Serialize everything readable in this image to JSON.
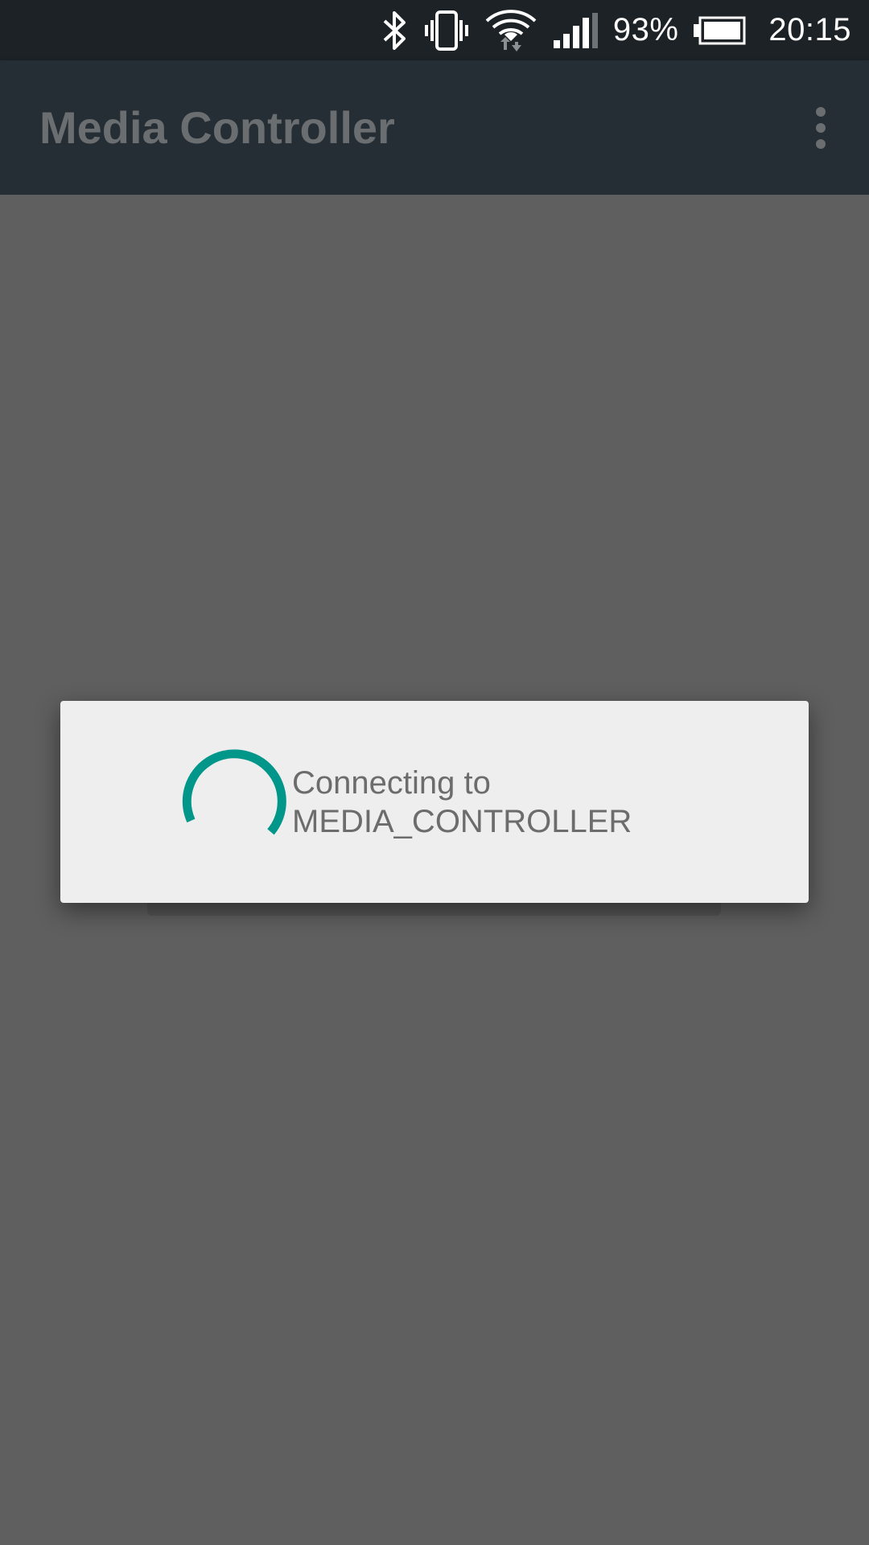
{
  "status_bar": {
    "icons": [
      "bluetooth-icon",
      "vibrate-icon",
      "wifi-icon",
      "signal-icon",
      "battery-icon"
    ],
    "battery_percent": "93%",
    "time": "20:15"
  },
  "app_bar": {
    "title": "Media Controller",
    "menu_icon": "more-vert-icon"
  },
  "dialog": {
    "message_line1": "Connecting to",
    "message_line2": "MEDIA_CONTROLLER",
    "spinner_color": "#00968a"
  },
  "colors": {
    "status_bar": "#1c2226",
    "app_bar": "#252e35",
    "scrim_background": "#5f5f5f",
    "dialog_background": "#eeeeee",
    "accent": "#00968a"
  }
}
